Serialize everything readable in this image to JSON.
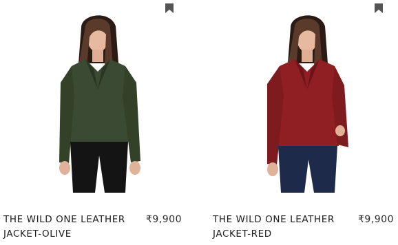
{
  "products": [
    {
      "title": "THE WILD ONE LEATHER JACKET-OLIVE",
      "price": "₹9,900",
      "wishlist_icon": "bookmark-icon",
      "jacket_color": "#3b4a32",
      "jacket_shadow": "#2a3524",
      "pants_color": "#141414"
    },
    {
      "title": "THE WILD ONE LEATHER JACKET-RED",
      "price": "₹9,900",
      "wishlist_icon": "bookmark-icon",
      "jacket_color": "#8f1f22",
      "jacket_shadow": "#6c1518",
      "pants_color": "#1d2a4a"
    }
  ]
}
